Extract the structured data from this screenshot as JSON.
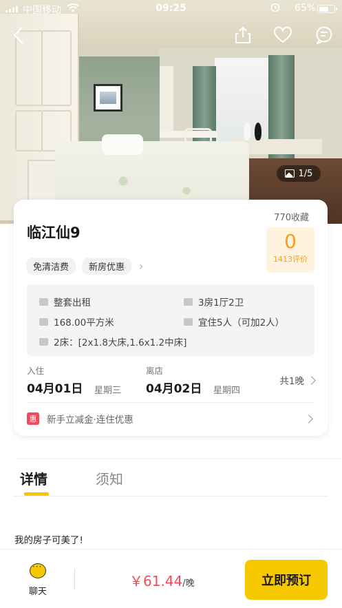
{
  "status_bar": {
    "carrier": "中国移动",
    "time": "09:25",
    "battery": "65%",
    "battery_level": 0.65
  },
  "header": {
    "icons": [
      "back-icon",
      "share-icon",
      "heart-icon",
      "message-icon"
    ]
  },
  "gallery": {
    "counter": "1/5"
  },
  "listing": {
    "title": "临江仙9",
    "favorites": "770收藏",
    "rating_score": "0",
    "rating_count": "1413评价",
    "tags": [
      "免清洁费",
      "新房优惠"
    ],
    "specs": {
      "rent_type": "整套出租",
      "layout": "3房1厅2卫",
      "area": "168.00平方米",
      "guests": "宜住5人（可加2人）",
      "beds": "2床：[2x1.8大床,1.6x1.2中床]"
    }
  },
  "dates": {
    "checkin_label": "入住",
    "checkin_date": "04月01日",
    "checkin_weekday": "星期三",
    "checkout_label": "离店",
    "checkout_date": "04月02日",
    "checkout_weekday": "星期四",
    "nights": "共1晚"
  },
  "promo": {
    "badge": "惠",
    "text": "新手立减金·连住优惠"
  },
  "tabs": [
    "详情",
    "须知"
  ],
  "description": "我的房子可美了!",
  "bottom_bar": {
    "chat_label": "聊天",
    "price": "￥61.44",
    "price_unit": "/晚",
    "book_button": "立即预订"
  },
  "colors": {
    "accent": "#f6c800",
    "price": "#f34a5b",
    "rating": "#f3a01d"
  }
}
